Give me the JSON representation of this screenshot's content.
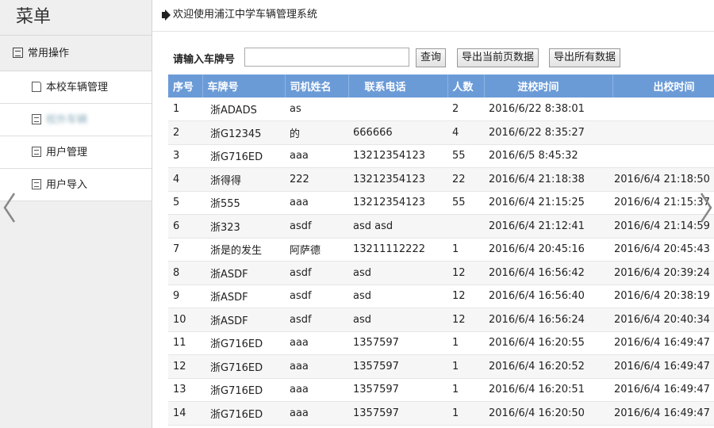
{
  "sidebar": {
    "title": "菜单",
    "group_label": "常用操作",
    "items": [
      {
        "label": "本校车辆管理"
      },
      {
        "label": "校外车辆"
      },
      {
        "label": "用户管理"
      },
      {
        "label": "用户导入"
      }
    ]
  },
  "header": {
    "welcome": "欢迎使用浦江中学车辆管理系统"
  },
  "toolbar": {
    "search_label": "请输入车牌号",
    "search_value": "",
    "query_label": "查询",
    "export_page_label": "导出当前页数据",
    "export_all_label": "导出所有数据"
  },
  "table": {
    "headers": [
      "序号",
      "车牌号",
      "司机姓名",
      "联系电话",
      "人数",
      "进校时间",
      "出校时间"
    ],
    "rows": [
      [
        "1",
        "浙ADADS",
        "as",
        "",
        "2",
        "2016/6/22 8:38:01",
        ""
      ],
      [
        "2",
        "浙G12345",
        "的",
        "666666",
        "4",
        "2016/6/22 8:35:27",
        ""
      ],
      [
        "3",
        "浙G716ED",
        "aaa",
        "13212354123",
        "55",
        "2016/6/5 8:45:32",
        ""
      ],
      [
        "4",
        "浙得得",
        "222",
        "13212354123",
        "22",
        "2016/6/4 21:18:38",
        "2016/6/4 21:18:50"
      ],
      [
        "5",
        "浙555",
        "aaa",
        "13212354123",
        "55",
        "2016/6/4 21:15:25",
        "2016/6/4 21:15:37"
      ],
      [
        "6",
        "浙323",
        "asdf",
        "asd      asd",
        "",
        "2016/6/4 21:12:41",
        "2016/6/4 21:14:59"
      ],
      [
        "7",
        "浙是的发生",
        "阿萨德",
        "13211112222",
        "1",
        "2016/6/4 20:45:16",
        "2016/6/4 20:45:43"
      ],
      [
        "8",
        "浙ASDF",
        "asdf",
        "asd",
        "12",
        "2016/6/4 16:56:42",
        "2016/6/4 20:39:24"
      ],
      [
        "9",
        "浙ASDF",
        "asdf",
        "asd",
        "12",
        "2016/6/4 16:56:40",
        "2016/6/4 20:38:19"
      ],
      [
        "10",
        "浙ASDF",
        "asdf",
        "asd",
        "12",
        "2016/6/4 16:56:24",
        "2016/6/4 20:40:34"
      ],
      [
        "11",
        "浙G716ED",
        "aaa",
        "1357597",
        "1",
        "2016/6/4 16:20:55",
        "2016/6/4 16:49:47"
      ],
      [
        "12",
        "浙G716ED",
        "aaa",
        "1357597",
        "1",
        "2016/6/4 16:20:52",
        "2016/6/4 16:49:47"
      ],
      [
        "13",
        "浙G716ED",
        "aaa",
        "1357597",
        "1",
        "2016/6/4 16:20:51",
        "2016/6/4 16:49:47"
      ],
      [
        "14",
        "浙G716ED",
        "aaa",
        "1357597",
        "1",
        "2016/6/4 16:20:50",
        "2016/6/4 16:49:47"
      ]
    ]
  },
  "colors": {
    "header_bg": "#6b9bd7",
    "sidebar_bg": "#efefef"
  }
}
